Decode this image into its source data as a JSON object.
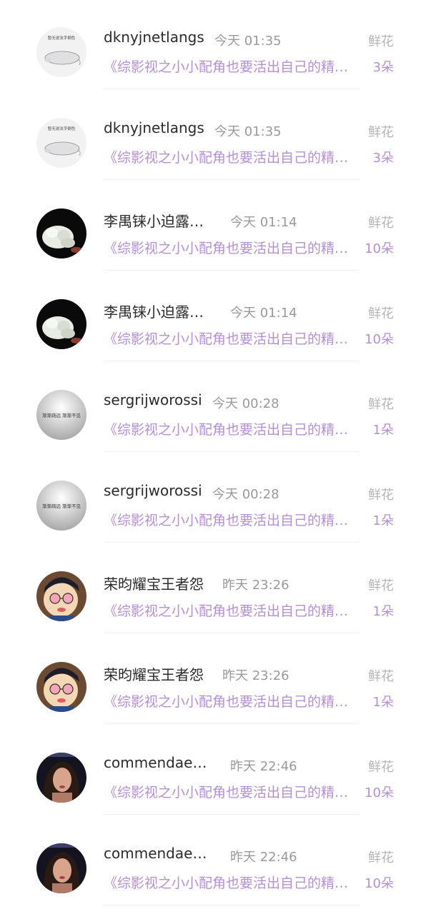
{
  "items": [
    {
      "name": "dknyjnetlangs",
      "time": "今天 01:35",
      "gift_label": "鲜花",
      "book": "《综影视之小小配角也要活出自己的精彩》",
      "count": "3朵",
      "avatar_text": "暂无说法字倒色"
    },
    {
      "name": "dknyjnetlangs",
      "time": "今天 01:35",
      "gift_label": "鲜花",
      "book": "《综影视之小小配角也要活出自己的精彩》",
      "count": "3朵",
      "avatar_text": "暂无说法字倒色"
    },
    {
      "name": "李禺铼小迫露…",
      "time": "今天 01:14",
      "gift_label": "鲜花",
      "book": "《综影视之小小配角也要活出自己的精彩》",
      "count": "10朵"
    },
    {
      "name": "李禺铼小迫露…",
      "time": "今天 01:14",
      "gift_label": "鲜花",
      "book": "《综影视之小小配角也要活出自己的精彩》",
      "count": "10朵"
    },
    {
      "name": "sergrijworossi",
      "time": "今天 00:28",
      "gift_label": "鲜花",
      "book": "《综影视之小小配角也要活出自己的精彩》",
      "count": "1朵",
      "avatar_text": "渐渐疏远  渐渐不见"
    },
    {
      "name": "sergrijworossi",
      "time": "今天 00:28",
      "gift_label": "鲜花",
      "book": "《综影视之小小配角也要活出自己的精彩》",
      "count": "1朵",
      "avatar_text": "渐渐疏远  渐渐不见"
    },
    {
      "name": "荣昀耀宝王者怨",
      "time": "昨天 23:26",
      "gift_label": "鲜花",
      "book": "《综影视之小小配角也要活出自己的精彩》",
      "count": "1朵"
    },
    {
      "name": "荣昀耀宝王者怨",
      "time": "昨天 23:26",
      "gift_label": "鲜花",
      "book": "《综影视之小小配角也要活出自己的精彩》",
      "count": "1朵"
    },
    {
      "name": "commendaes…",
      "time": "昨天 22:46",
      "gift_label": "鲜花",
      "book": "《综影视之小小配角也要活出自己的精彩》",
      "count": "10朵"
    },
    {
      "name": "commendaes…",
      "time": "昨天 22:46",
      "gift_label": "鲜花",
      "book": "《综影视之小小配角也要活出自己的精彩》",
      "count": "10朵"
    }
  ]
}
